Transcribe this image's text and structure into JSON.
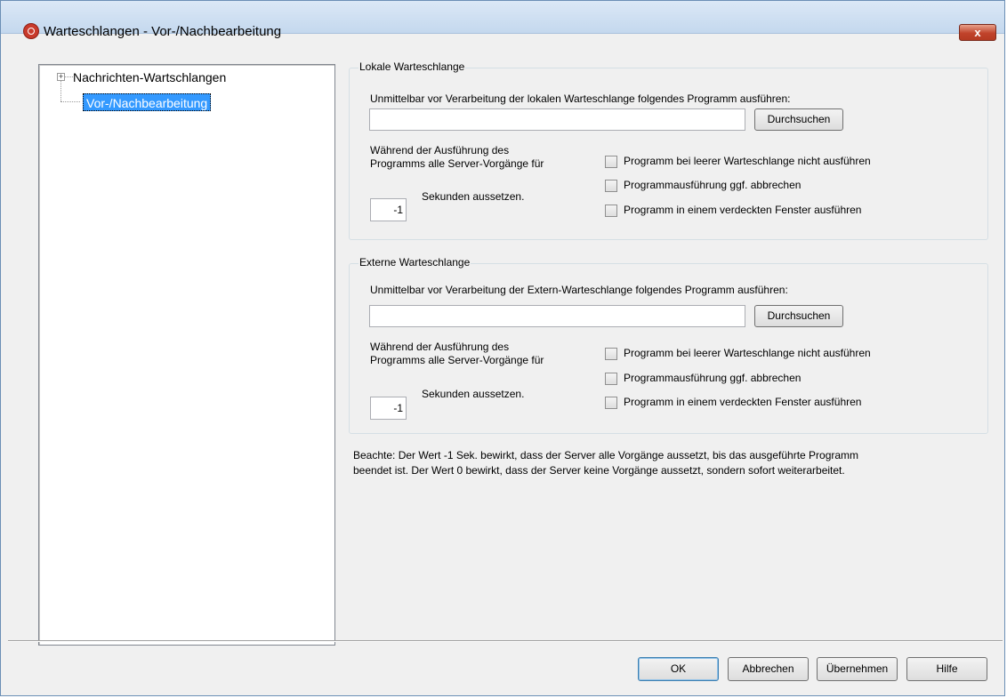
{
  "window": {
    "title": "Warteschlangen - Vor-/Nachbearbeitung",
    "close_label": "x"
  },
  "tree": {
    "items": [
      {
        "label": "Nachrichten-Wartschlangen",
        "expander": "+",
        "selected": false
      },
      {
        "label": "Vor-/Nachbearbeitung",
        "selected": true
      }
    ]
  },
  "local": {
    "legend": "Lokale Warteschlange",
    "instruction": "Unmittelbar vor Verarbeitung der lokalen Warteschlange folgendes Programm ausführen:",
    "program_value": "",
    "browse_label": "Durchsuchen",
    "pause_line1": "Während der Ausführung des",
    "pause_line2": "Programms alle Server-Vorgänge für",
    "seconds_value": "-1",
    "seconds_label": "Sekunden aussetzen.",
    "options": [
      {
        "label": "Programm bei leerer Warteschlange nicht ausführen",
        "checked": false
      },
      {
        "label": "Programmausführung ggf. abbrechen",
        "checked": false
      },
      {
        "label": "Programm in einem verdeckten Fenster ausführen",
        "checked": false
      }
    ]
  },
  "external": {
    "legend": "Externe Warteschlange",
    "instruction": "Unmittelbar vor Verarbeitung der Extern-Warteschlange folgendes Programm ausführen:",
    "program_value": "",
    "browse_label": "Durchsuchen",
    "pause_line1": "Während der Ausführung des",
    "pause_line2": "Programms alle Server-Vorgänge für",
    "seconds_value": "-1",
    "seconds_label": "Sekunden aussetzen.",
    "options": [
      {
        "label": "Programm bei leerer Warteschlange nicht ausführen",
        "checked": false
      },
      {
        "label": "Programmausführung ggf. abbrechen",
        "checked": false
      },
      {
        "label": "Programm in einem verdeckten Fenster ausführen",
        "checked": false
      }
    ]
  },
  "note": {
    "line1": "Beachte: Der Wert -1 Sek. bewirkt, dass der Server alle Vorgänge aussetzt, bis das ausgeführte Programm",
    "line2": "beendet ist. Der Wert 0 bewirkt, dass der Server keine Vorgänge aussetzt, sondern sofort weiterarbeitet."
  },
  "buttons": {
    "ok": "OK",
    "cancel": "Abbrechen",
    "apply": "Übernehmen",
    "help": "Hilfe"
  },
  "colors": {
    "selection": "#3399ff",
    "close_button": "#c0432b",
    "group_border": "#d5dfe5"
  }
}
